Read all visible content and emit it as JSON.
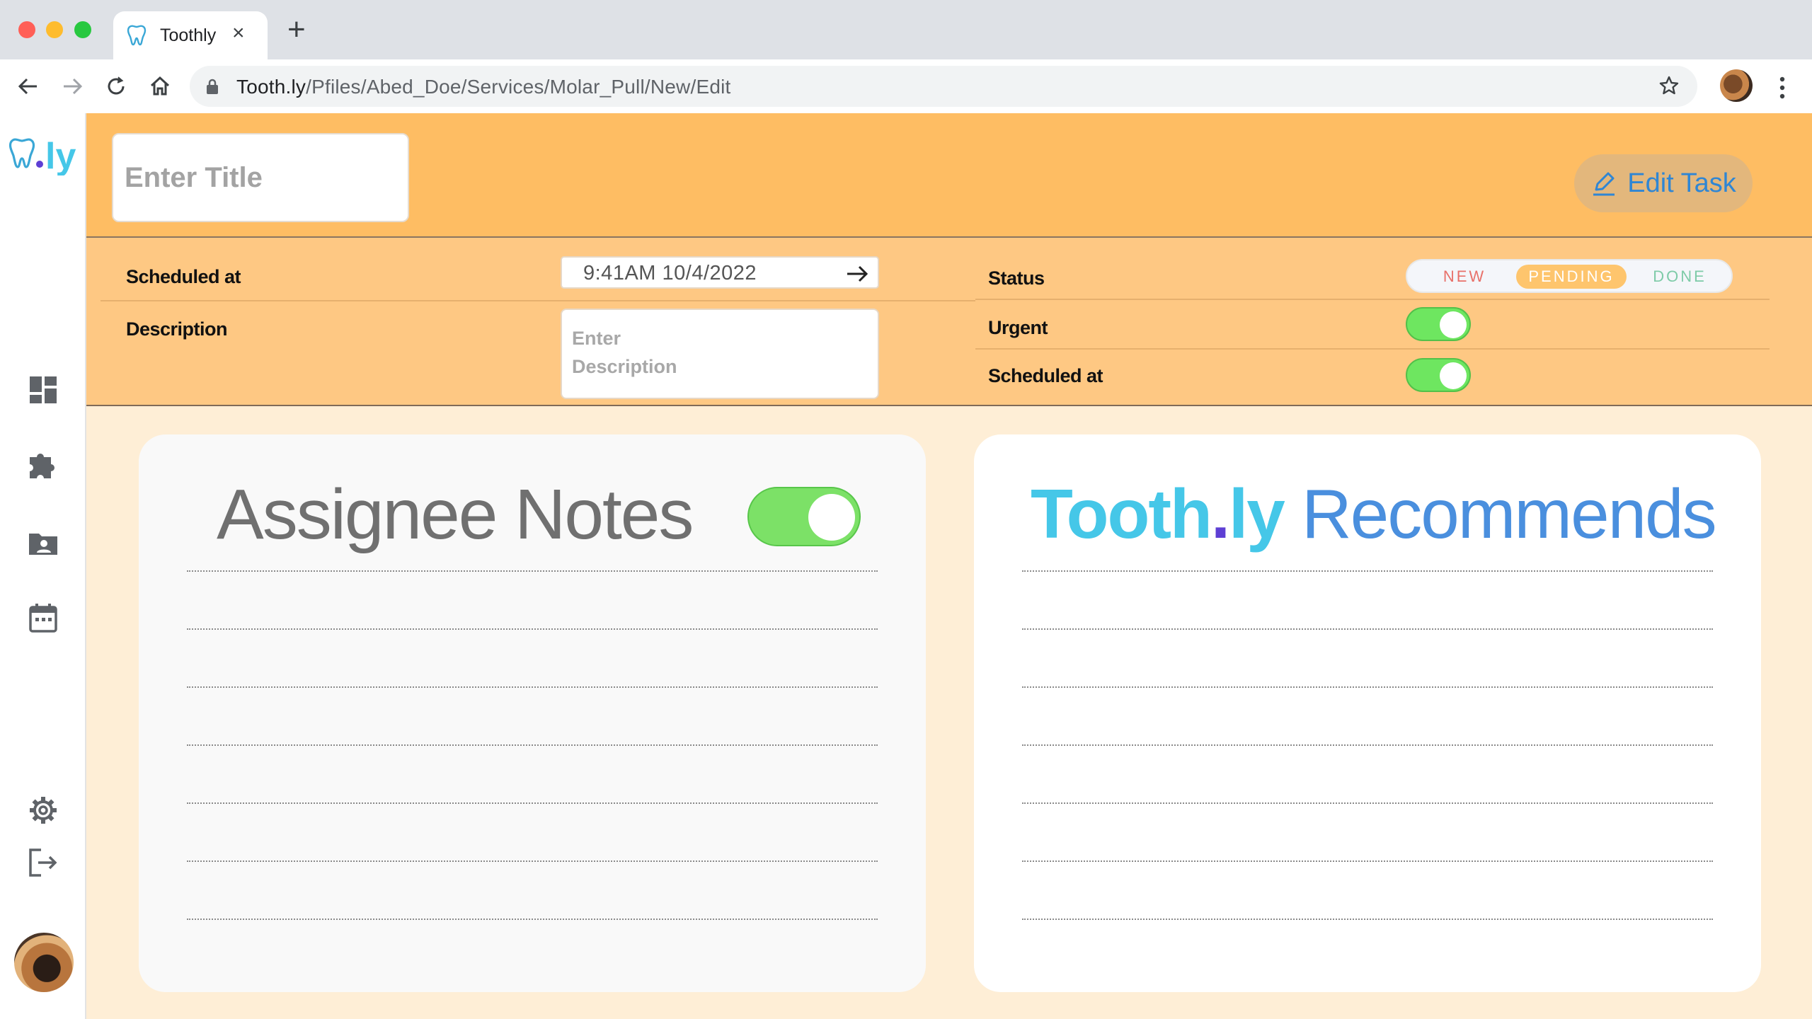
{
  "browser": {
    "tab_title": "Toothly",
    "new_tab": "+",
    "tab_close": "×",
    "url_host": "Tooth.ly",
    "url_path": "/Pfiles/Abed_Doe/Services/Molar_Pull/New/Edit"
  },
  "header": {
    "title_placeholder": "Enter Title",
    "edit_task_label": "Edit Task"
  },
  "details": {
    "scheduled_label": "Scheduled at",
    "scheduled_value": "9:41AM 10/4/2022",
    "description_label": "Description",
    "description_placeholder": "Enter\nDescription",
    "status_label": "Status",
    "status_options": [
      "NEW",
      "PENDING",
      "DONE"
    ],
    "status_selected": "PENDING",
    "urgent_label": "Urgent",
    "urgent_on": true,
    "scheduled_toggle_label": "Scheduled at",
    "scheduled_toggle_on": true
  },
  "cards": {
    "notes_title": "Assignee Notes",
    "notes_toggle_on": true,
    "rec_brand": "Tooth",
    "rec_dot": ".",
    "rec_brand2": "ly",
    "rec_word": "Recommends"
  },
  "icons": [
    "dashboard-icon",
    "puzzle-icon",
    "patient-folder-icon",
    "calendar-icon",
    "settings-icon",
    "logout-icon"
  ],
  "colors": {
    "header": "#febd63",
    "details": "#fec883",
    "main_bg": "#feeed6",
    "toggle_on": "#6ee660",
    "brand_cyan": "#45c7e8",
    "brand_blue": "#4a8fde"
  }
}
